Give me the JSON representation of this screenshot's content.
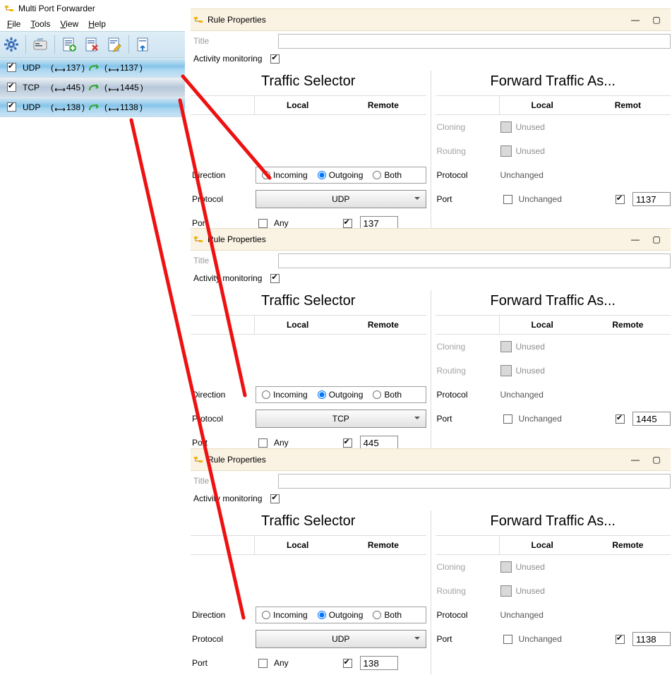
{
  "app": {
    "title": "Multi Port Forwarder"
  },
  "menu": {
    "file": "File",
    "tools": "Tools",
    "view": "View",
    "help": "Help"
  },
  "rules": [
    {
      "proto": "UDP",
      "srcPort": "137",
      "dstPort": "1137"
    },
    {
      "proto": "TCP",
      "srcPort": "445",
      "dstPort": "1445"
    },
    {
      "proto": "UDP",
      "srcPort": "138",
      "dstPort": "1138"
    }
  ],
  "rp_common": {
    "window_title": "Rule Properties",
    "title_label": "Title",
    "activity_label": "Activity monitoring",
    "ts_heading": "Traffic Selector",
    "fta_heading": "Forward Traffic As...",
    "col_local": "Local",
    "col_remote": "Remote",
    "cloning": "Cloning",
    "routing": "Routing",
    "direction": "Direction",
    "protocol": "Protocol",
    "port": "Port",
    "incoming": "Incoming",
    "outgoing": "Outgoing",
    "both": "Both",
    "any": "Any",
    "unused": "Unused",
    "unchanged": "Unchanged"
  },
  "rp": [
    {
      "protocol": "UDP",
      "port": "137",
      "fwd_port": "1137",
      "remote_label": "Remote",
      "fwd_remote_label": "Remot"
    },
    {
      "protocol": "TCP",
      "port": "445",
      "fwd_port": "1445",
      "remote_label": "Remote",
      "fwd_remote_label": "Remote"
    },
    {
      "protocol": "UDP",
      "port": "138",
      "fwd_port": "1138",
      "remote_label": "Remote",
      "fwd_remote_label": "Remote"
    }
  ]
}
